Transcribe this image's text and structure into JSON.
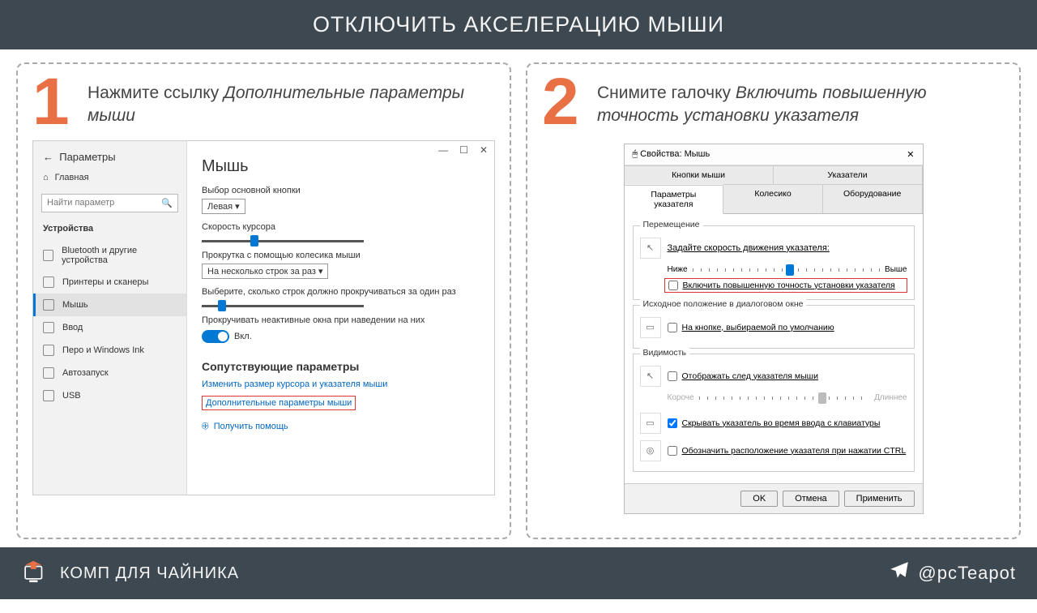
{
  "title": "ОТКЛЮЧИТЬ АКСЕЛЕРАЦИЮ МЫШИ",
  "steps": {
    "s1": {
      "num": "1",
      "caption_plain": "Нажмите ссылку ",
      "caption_italic": "Дополнительные параметры мыши"
    },
    "s2": {
      "num": "2",
      "caption_plain": "Снимите галочку ",
      "caption_italic": "Включить повышенную точность установки указателя"
    }
  },
  "settings": {
    "back": "←",
    "app_title": "Параметры",
    "home": "Главная",
    "search_placeholder": "Найти параметр",
    "category": "Устройства",
    "items": [
      "Bluetooth и другие устройства",
      "Принтеры и сканеры",
      "Мышь",
      "Ввод",
      "Перо и Windows Ink",
      "Автозапуск",
      "USB"
    ],
    "main_title": "Мышь",
    "primary_btn_label": "Выбор основной кнопки",
    "primary_btn_value": "Левая  ▾",
    "cursor_speed": "Скорость курсора",
    "scroll_label": "Прокрутка с помощью колесика мыши",
    "scroll_value": "На несколько строк за раз  ▾",
    "lines_label": "Выберите, сколько строк должно прокручиваться за один раз",
    "inactive_label": "Прокручивать неактивные окна при наведении на них",
    "toggle_on": "Вкл.",
    "related_head": "Сопутствующие параметры",
    "link1": "Изменить размер курсора и указателя мыши",
    "link2": "Дополнительные параметры мыши",
    "help": "Получить помощь"
  },
  "props": {
    "title": "Свойства: Мышь",
    "tabs_row1": [
      "Кнопки мыши",
      "Указатели"
    ],
    "tabs_row2": [
      "Параметры указателя",
      "Колесико",
      "Оборудование"
    ],
    "g1": {
      "title": "Перемещение",
      "label": "Задайте скорость движения указателя:",
      "low": "Ниже",
      "high": "Выше",
      "chk": "Включить повышенную точность установки указателя"
    },
    "g2": {
      "title": "Исходное положение в диалоговом окне",
      "chk": "На кнопке, выбираемой по умолчанию"
    },
    "g3": {
      "title": "Видимость",
      "chk1": "Отображать след указателя мыши",
      "short": "Короче",
      "long": "Длиннее",
      "chk2": "Скрывать указатель во время ввода с клавиатуры",
      "chk3": "Обозначить расположение указателя при нажатии CTRL"
    },
    "buttons": {
      "ok": "OK",
      "cancel": "Отмена",
      "apply": "Применить"
    }
  },
  "footer": {
    "brand": "КОМП ДЛЯ ЧАЙНИКА",
    "handle": "@pcTeapot"
  }
}
